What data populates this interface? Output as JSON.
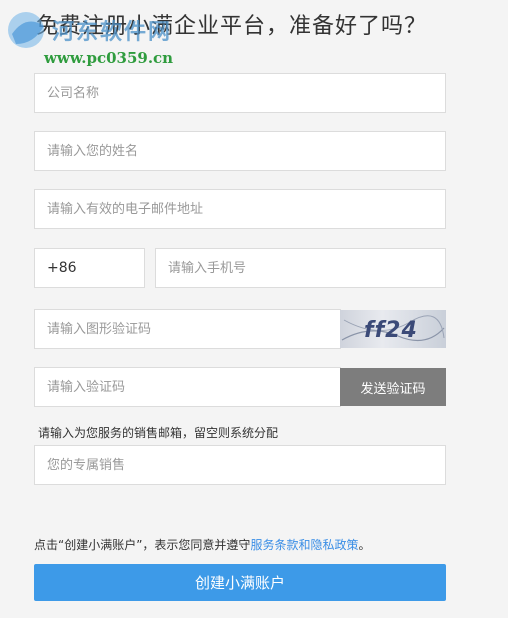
{
  "page": {
    "title": "免费注册小满企业平台，准备好了吗？"
  },
  "watermark": {
    "name": "河东软件网",
    "site": "www.pc0359.cn"
  },
  "form": {
    "company_placeholder": "公司名称",
    "name_placeholder": "请输入您的姓名",
    "email_placeholder": "请输入有效的电子邮件地址",
    "country_code": "+86",
    "phone_placeholder": "请输入手机号",
    "captcha_placeholder": "请输入图形验证码",
    "captcha_text": "ff24",
    "sms_code_placeholder": "请输入验证码",
    "send_code_label": "发送验证码",
    "sales_hint": "请输入为您服务的销售邮箱，留空则系统分配",
    "sales_placeholder": "您的专属销售"
  },
  "agreement": {
    "prefix": "点击“创建小满账户”，表示您同意并遵守",
    "link": "服务条款和隐私政策",
    "suffix": "。"
  },
  "submit_label": "创建小满账户",
  "colors": {
    "primary": "#3d9ae8",
    "link": "#3a8ee6",
    "send_button": "#7d7d7d"
  }
}
